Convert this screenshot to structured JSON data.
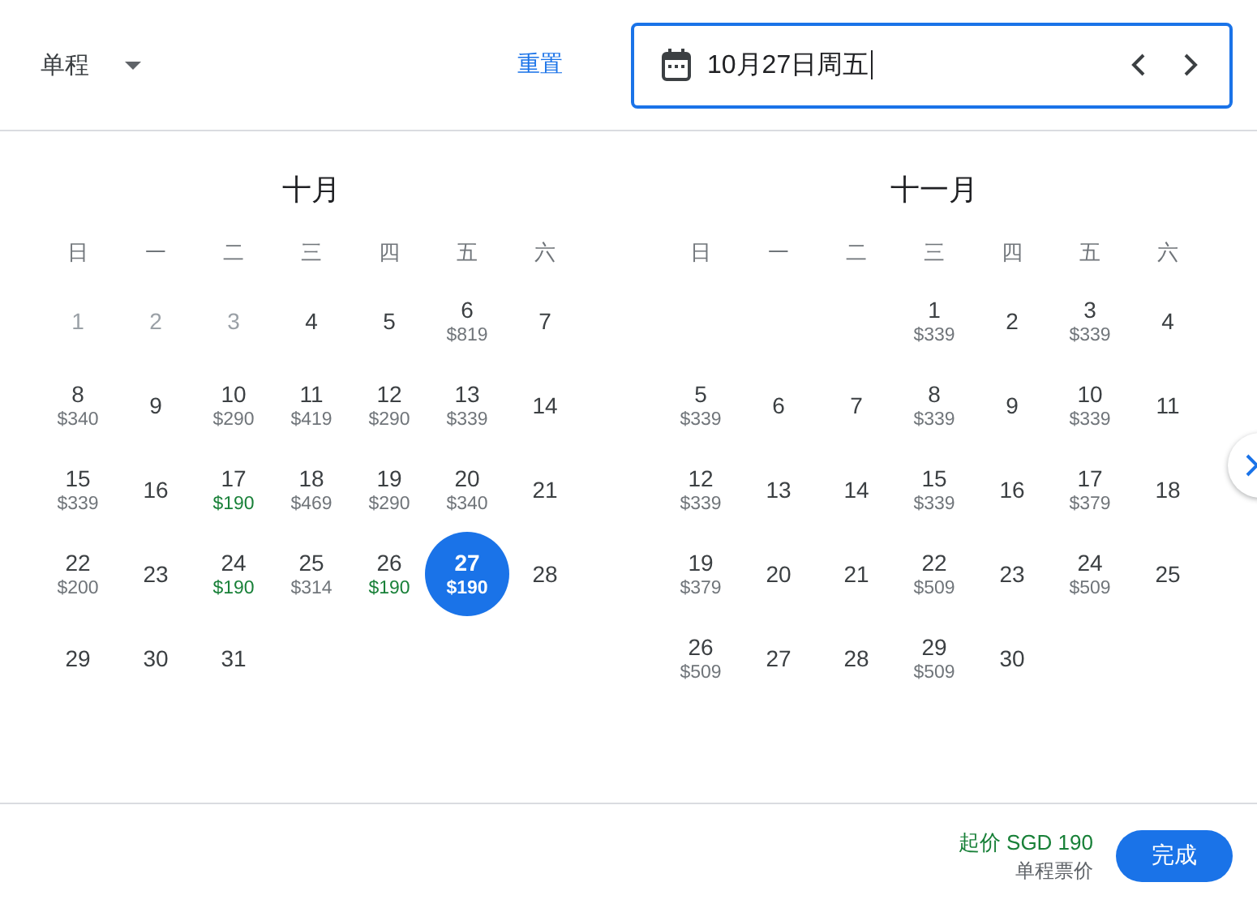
{
  "trip_type": {
    "label": "单程"
  },
  "reset_link": "重置",
  "date_field": {
    "value": "10月27日周五"
  },
  "months": [
    {
      "title": "十月",
      "weekdays": [
        "日",
        "一",
        "二",
        "三",
        "四",
        "五",
        "六"
      ],
      "weeks": [
        [
          {
            "day": "1",
            "disabled": true,
            "selected": false
          },
          {
            "day": "2",
            "disabled": true,
            "selected": false
          },
          {
            "day": "3",
            "disabled": true,
            "selected": false
          },
          {
            "day": "4",
            "disabled": false,
            "selected": false
          },
          {
            "day": "5",
            "disabled": false,
            "selected": false
          },
          {
            "day": "6",
            "price": "$819",
            "cheapest": false,
            "disabled": false,
            "selected": false
          },
          {
            "day": "7",
            "disabled": false,
            "selected": false
          }
        ],
        [
          {
            "day": "8",
            "price": "$340",
            "cheapest": false,
            "disabled": false,
            "selected": false
          },
          {
            "day": "9",
            "disabled": false,
            "selected": false
          },
          {
            "day": "10",
            "price": "$290",
            "cheapest": false,
            "disabled": false,
            "selected": false
          },
          {
            "day": "11",
            "price": "$419",
            "cheapest": false,
            "disabled": false,
            "selected": false
          },
          {
            "day": "12",
            "price": "$290",
            "cheapest": false,
            "disabled": false,
            "selected": false
          },
          {
            "day": "13",
            "price": "$339",
            "cheapest": false,
            "disabled": false,
            "selected": false
          },
          {
            "day": "14",
            "disabled": false,
            "selected": false
          }
        ],
        [
          {
            "day": "15",
            "price": "$339",
            "cheapest": false,
            "disabled": false,
            "selected": false
          },
          {
            "day": "16",
            "disabled": false,
            "selected": false
          },
          {
            "day": "17",
            "price": "$190",
            "cheapest": true,
            "disabled": false,
            "selected": false
          },
          {
            "day": "18",
            "price": "$469",
            "cheapest": false,
            "disabled": false,
            "selected": false
          },
          {
            "day": "19",
            "price": "$290",
            "cheapest": false,
            "disabled": false,
            "selected": false
          },
          {
            "day": "20",
            "price": "$340",
            "cheapest": false,
            "disabled": false,
            "selected": false
          },
          {
            "day": "21",
            "disabled": false,
            "selected": false
          }
        ],
        [
          {
            "day": "22",
            "price": "$200",
            "cheapest": false,
            "disabled": false,
            "selected": false
          },
          {
            "day": "23",
            "disabled": false,
            "selected": false
          },
          {
            "day": "24",
            "price": "$190",
            "cheapest": true,
            "disabled": false,
            "selected": false
          },
          {
            "day": "25",
            "price": "$314",
            "cheapest": false,
            "disabled": false,
            "selected": false
          },
          {
            "day": "26",
            "price": "$190",
            "cheapest": true,
            "disabled": false,
            "selected": false
          },
          {
            "day": "27",
            "price": "$190",
            "cheapest": true,
            "disabled": false,
            "selected": true
          },
          {
            "day": "28",
            "disabled": false,
            "selected": false
          }
        ],
        [
          {
            "day": "29",
            "disabled": false,
            "selected": false
          },
          {
            "day": "30",
            "disabled": false,
            "selected": false
          },
          {
            "day": "31",
            "disabled": false,
            "selected": false
          }
        ]
      ]
    },
    {
      "title": "十一月",
      "weekdays": [
        "日",
        "一",
        "二",
        "三",
        "四",
        "五",
        "六"
      ],
      "weeks": [
        [
          {
            "day": "1",
            "price": "$339",
            "cheapest": false,
            "disabled": false,
            "selected": false
          },
          {
            "day": "2",
            "disabled": false,
            "selected": false
          },
          {
            "day": "3",
            "price": "$339",
            "cheapest": false,
            "disabled": false,
            "selected": false
          },
          {
            "day": "4",
            "disabled": false,
            "selected": false
          }
        ],
        [
          {
            "day": "5",
            "price": "$339",
            "cheapest": false,
            "disabled": false,
            "selected": false
          },
          {
            "day": "6",
            "disabled": false,
            "selected": false
          },
          {
            "day": "7",
            "disabled": false,
            "selected": false
          },
          {
            "day": "8",
            "price": "$339",
            "cheapest": false,
            "disabled": false,
            "selected": false
          },
          {
            "day": "9",
            "disabled": false,
            "selected": false
          },
          {
            "day": "10",
            "price": "$339",
            "cheapest": false,
            "disabled": false,
            "selected": false
          },
          {
            "day": "11",
            "disabled": false,
            "selected": false
          }
        ],
        [
          {
            "day": "12",
            "price": "$339",
            "cheapest": false,
            "disabled": false,
            "selected": false
          },
          {
            "day": "13",
            "disabled": false,
            "selected": false
          },
          {
            "day": "14",
            "disabled": false,
            "selected": false
          },
          {
            "day": "15",
            "price": "$339",
            "cheapest": false,
            "disabled": false,
            "selected": false
          },
          {
            "day": "16",
            "disabled": false,
            "selected": false
          },
          {
            "day": "17",
            "price": "$379",
            "cheapest": false,
            "disabled": false,
            "selected": false
          },
          {
            "day": "18",
            "disabled": false,
            "selected": false
          }
        ],
        [
          {
            "day": "19",
            "price": "$379",
            "cheapest": false,
            "disabled": false,
            "selected": false
          },
          {
            "day": "20",
            "disabled": false,
            "selected": false
          },
          {
            "day": "21",
            "disabled": false,
            "selected": false
          },
          {
            "day": "22",
            "price": "$509",
            "cheapest": false,
            "disabled": false,
            "selected": false
          },
          {
            "day": "23",
            "disabled": false,
            "selected": false
          },
          {
            "day": "24",
            "price": "$509",
            "cheapest": false,
            "disabled": false,
            "selected": false
          },
          {
            "day": "25",
            "disabled": false,
            "selected": false
          }
        ],
        [
          {
            "day": "26",
            "price": "$509",
            "cheapest": false,
            "disabled": false,
            "selected": false
          },
          {
            "day": "27",
            "disabled": false,
            "selected": false
          },
          {
            "day": "28",
            "disabled": false,
            "selected": false
          },
          {
            "day": "29",
            "price": "$509",
            "cheapest": false,
            "disabled": false,
            "selected": false
          },
          {
            "day": "30",
            "disabled": false,
            "selected": false
          }
        ]
      ]
    }
  ],
  "footer": {
    "price": "起价 SGD 190",
    "caption": "单程票价",
    "button": "完成"
  }
}
